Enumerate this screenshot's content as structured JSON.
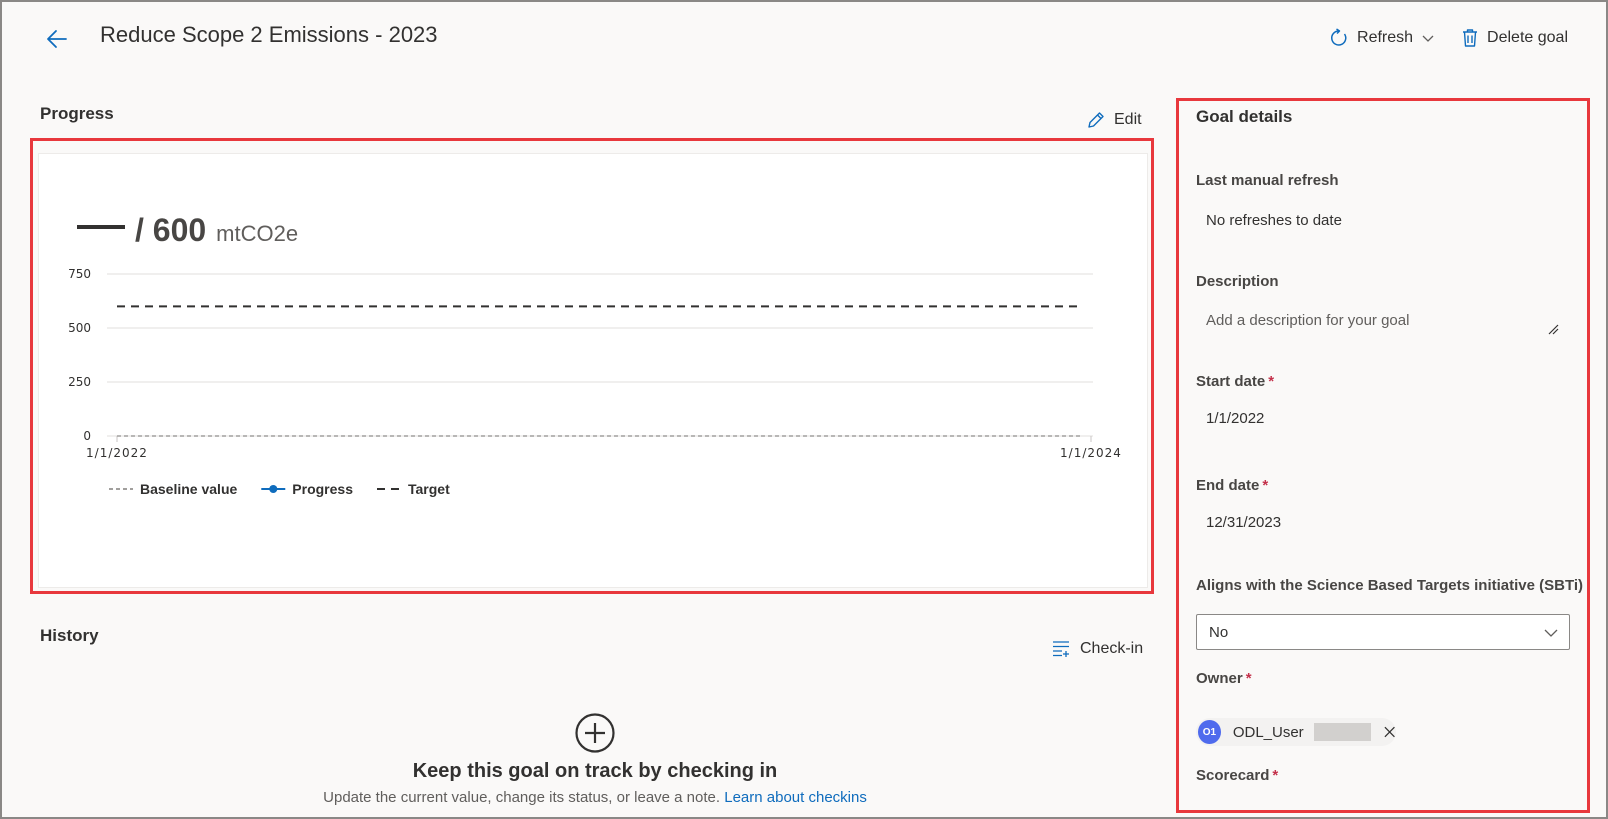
{
  "header": {
    "title": "Reduce Scope 2 Emissions - 2023",
    "refresh_label": "Refresh",
    "delete_label": "Delete goal"
  },
  "progress": {
    "section_title": "Progress",
    "edit_label": "Edit",
    "current_value_display": "—",
    "target_value": "/ 600",
    "unit": "mtCO2e"
  },
  "chart_data": {
    "type": "line",
    "x_ticks": [
      "1/1/2022",
      "1/1/2024"
    ],
    "y_ticks": [
      0,
      250,
      500,
      750
    ],
    "ylim": [
      0,
      750
    ],
    "grid": true,
    "series": [
      {
        "name": "Baseline value",
        "style": "dashed",
        "color": "#a19f9d",
        "values": [
          0,
          0
        ]
      },
      {
        "name": "Progress",
        "style": "line-marker",
        "color": "#0f6cbd",
        "values": []
      },
      {
        "name": "Target",
        "style": "dashed",
        "color": "#323130",
        "values": [
          600,
          600
        ]
      }
    ],
    "legend_position": "bottom-left"
  },
  "history": {
    "section_title": "History",
    "checkin_label": "Check-in",
    "empty_title": "Keep this goal on track by checking in",
    "empty_subtitle": "Update the current value, change its status, or leave a note.",
    "empty_link": "Learn about checkins"
  },
  "details": {
    "title": "Goal details",
    "last_refresh_label": "Last manual refresh",
    "last_refresh_value": "No refreshes to date",
    "description_label": "Description",
    "description_placeholder": "Add a description for your goal",
    "start_date_label": "Start date",
    "start_date_value": "1/1/2022",
    "end_date_label": "End date",
    "end_date_value": "12/31/2023",
    "sbti_label": "Aligns with the Science Based Targets initiative (SBTi)",
    "sbti_value": "No",
    "owner_label": "Owner",
    "owner_initials": "O1",
    "owner_name": "ODL_User",
    "scorecard_label": "Scorecard",
    "required_mark": "*"
  },
  "colors": {
    "accent": "#0f6cbd",
    "highlight_border": "#e8383d",
    "avatar": "#4f6bed"
  }
}
